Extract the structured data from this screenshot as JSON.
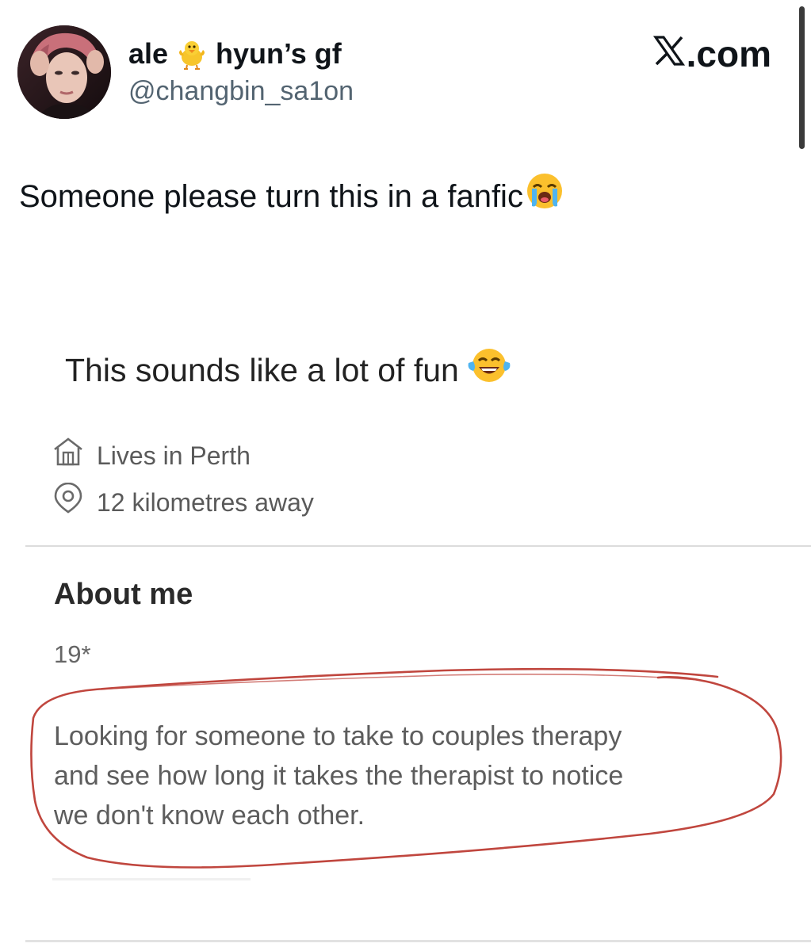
{
  "tweet": {
    "author": {
      "name_part1": "ale",
      "name_emoji": "baby-chick-icon",
      "name_part2": "hyun’s gf",
      "handle": "@changbin_sa1on"
    },
    "source_label": ".com",
    "text": "Someone please turn this in a fanfic",
    "text_emoji": "loudly-crying-face-icon"
  },
  "embedded_profile": {
    "heading": "This sounds like a lot of fun",
    "heading_emoji": "face-with-tears-of-joy-icon",
    "location": "Lives in Perth",
    "distance": "12 kilometres away",
    "about_title": "About me",
    "age": "19*",
    "bio_lines": [
      "Looking for someone to take to couples therapy",
      "and see how  long it takes the therapist to notice",
      "we don't know each other."
    ],
    "annotation_color": "#c0463e"
  }
}
